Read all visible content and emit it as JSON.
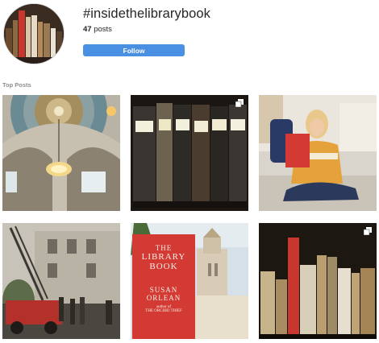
{
  "header": {
    "hashtag": "#insidethelibrarybook",
    "post_count": "47",
    "post_count_label": "posts",
    "follow_label": "Follow"
  },
  "top_posts": {
    "title": "Top Posts",
    "posts": [
      {
        "description": "rotunda ceiling with chandelier",
        "multiple": false
      },
      {
        "description": "row of antique book spines",
        "multiple": true
      },
      {
        "description": "woman reading a red book on a sofa",
        "multiple": false
      },
      {
        "description": "firefighters with ladder truck",
        "multiple": false
      },
      {
        "description": "book cover in front of library tower",
        "multiple": false
      },
      {
        "description": "shelf of old books",
        "multiple": true
      }
    ]
  },
  "book_cover": {
    "line1": "THE",
    "line2": "LIBRARY",
    "line3": "BOOK",
    "author1": "SUSAN",
    "author2": "ORLEAN",
    "tagline1": "author of",
    "tagline2": "THE ORCHID THIEF"
  },
  "colors": {
    "follow_button": "#4a90e2",
    "book_red": "#d23a33"
  }
}
